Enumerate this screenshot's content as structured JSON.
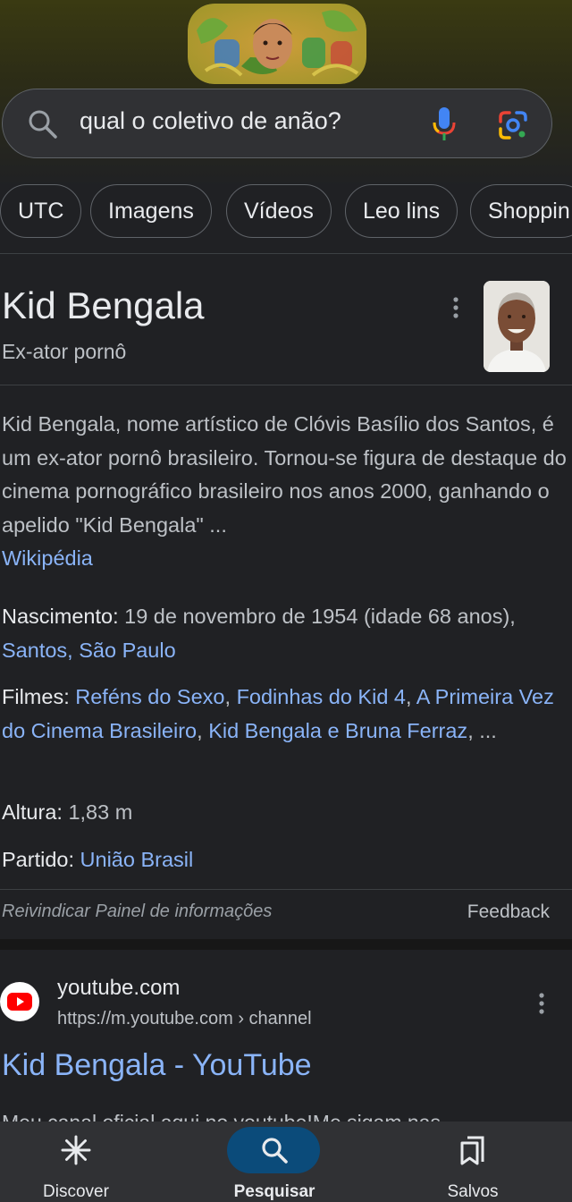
{
  "search": {
    "query": "qual o coletivo de anão?"
  },
  "chips": [
    "UTC",
    "Imagens",
    "Vídeos",
    "Leo lins",
    "Shoppin"
  ],
  "knowledge_panel": {
    "title": "Kid Bengala",
    "subtitle": "Ex-ator pornô",
    "description": "Kid Bengala, nome artístico de Clóvis Basílio dos Santos, é um ex-ator pornô brasileiro. Tornou-se figura de destaque do cinema pornográfico brasileiro nos anos 2000, ganhando o apelido \"Kid Bengala\" ...",
    "source_link": "Wikipédia",
    "facts": {
      "birth_label": "Nascimento:",
      "birth_value": " 19 de novembro de 1954 (idade 68 anos), ",
      "birth_place": "Santos, São Paulo",
      "films_label": "Filmes:",
      "films": [
        "Reféns do Sexo",
        "Fodinhas do Kid 4",
        "A Primeira Vez do Cinema Brasileiro",
        "Kid Bengala e Bruna Ferraz"
      ],
      "films_sep": ", ",
      "films_more": ", ...",
      "height_label": "Altura:",
      "height_value": " 1,83 m",
      "party_label": "Partido:",
      "party_value": "União Brasil"
    },
    "claim_text": "Reivindicar Painel de informações",
    "feedback_text": "Feedback"
  },
  "result": {
    "site_name": "youtube.com",
    "url": "https://m.youtube.com",
    "breadcrumb": " › channel",
    "title": "Kid Bengala - YouTube",
    "snippet": "Meu canal oficial aqui no youtube!Me sigam nas"
  },
  "bottom_nav": {
    "items": [
      {
        "label": "Discover",
        "icon": "asterisk-icon"
      },
      {
        "label": "Pesquisar",
        "icon": "search-icon"
      },
      {
        "label": "Salvos",
        "icon": "bookmarks-icon"
      }
    ],
    "active": "Pesquisar"
  },
  "colors": {
    "background": "#202124",
    "link": "#8ab4f8",
    "nav_active_pill": "#0b4b7a"
  }
}
